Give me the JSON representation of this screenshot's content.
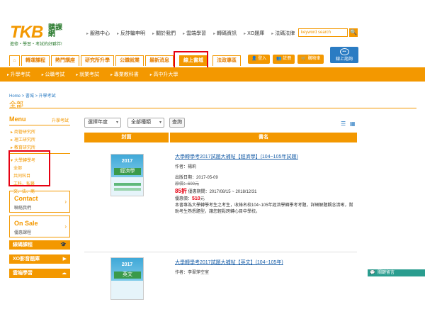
{
  "logo": {
    "tkb": "TKB",
    "kz": "購課網",
    "slogan": "進修・學習・考試的好夥伴!"
  },
  "topnav": [
    "服務中心",
    "反詐騙申明",
    "關於我們",
    "雲端學習",
    "轉碼資訊",
    "XO題庫",
    "法碼法律"
  ],
  "search": {
    "placeholder": "keyword search",
    "button": "🔍"
  },
  "mainnav": {
    "home": "⌂",
    "tabs": [
      "轉運課程",
      "熱門講座",
      "研究所升學",
      "公職就業",
      "最新消息",
      "線上書城",
      "法政專區"
    ],
    "active": "線上書城"
  },
  "rightbuttons": [
    "登入",
    "註冊",
    "購物車"
  ],
  "online": {
    "label": "線上諮詢"
  },
  "subnav": [
    "升學考試",
    "公職考試",
    "就業考試",
    "專業教科書",
    "高中升大學"
  ],
  "breadcrumb": "Home > 書城 > 升學考試",
  "page_title": "全部",
  "sidebar": {
    "menu_title": "Menu",
    "menu_side": "升學考試",
    "items": [
      {
        "label": "商管研究所"
      },
      {
        "label": "理工研究所"
      },
      {
        "label": "教育研究所"
      },
      {
        "label": "大學轉學考"
      }
    ],
    "subitems": [
      "全部",
      "共同科目",
      "工科、私醫",
      "文、法、商"
    ],
    "boxes": [
      {
        "big": "Contact",
        "small": "聯絡我們",
        "arrow": "›"
      },
      {
        "big": "On Sale",
        "small": "優惠課程",
        "arrow": "›"
      }
    ],
    "bars": [
      {
        "label": "線碼課程",
        "icon": "🎓"
      },
      {
        "label": "XO影音題庫",
        "icon": "▶"
      },
      {
        "label": "雲端學習",
        "icon": "☁"
      }
    ]
  },
  "filters": {
    "year": "選擇年度",
    "type": "全部種類",
    "query": "查詢",
    "caret": "▾",
    "view_list": "☰",
    "view_grid": "▦"
  },
  "table": {
    "col_cover": "封面",
    "col_name": "書名"
  },
  "books": [
    {
      "cover_title": "2017",
      "cover_subject": "經濟學",
      "title": "大學轉學考2017試題大補帖【經濟學】(104~105年試題)",
      "author_label": "作者：",
      "author": "楊莉",
      "pubdate_label": "出版日期：",
      "pubdate": "2017-05-09",
      "orig_price": "原價：600元",
      "discount": "85折",
      "discount_period": " 優惠期間：2017/08/15 ~ 2018/12/31",
      "sale_label": "優惠價：",
      "sale_price": "510",
      "sale_unit": "元",
      "description": "本書專為大學轉學考生之考生，收錄名校104~105年經濟學轉學考考題，詳細解題觀念清晰，幫助考生熟悉題型，讓您輕鬆跨轉心目中學校。"
    },
    {
      "cover_title": "2017",
      "cover_subject": "英文",
      "title": "大學轉學考2017試題大補帖【英文】(104~105年)",
      "author_label": "作者：",
      "author": "李翠萍空室"
    }
  ],
  "chat": "關鍵留言"
}
